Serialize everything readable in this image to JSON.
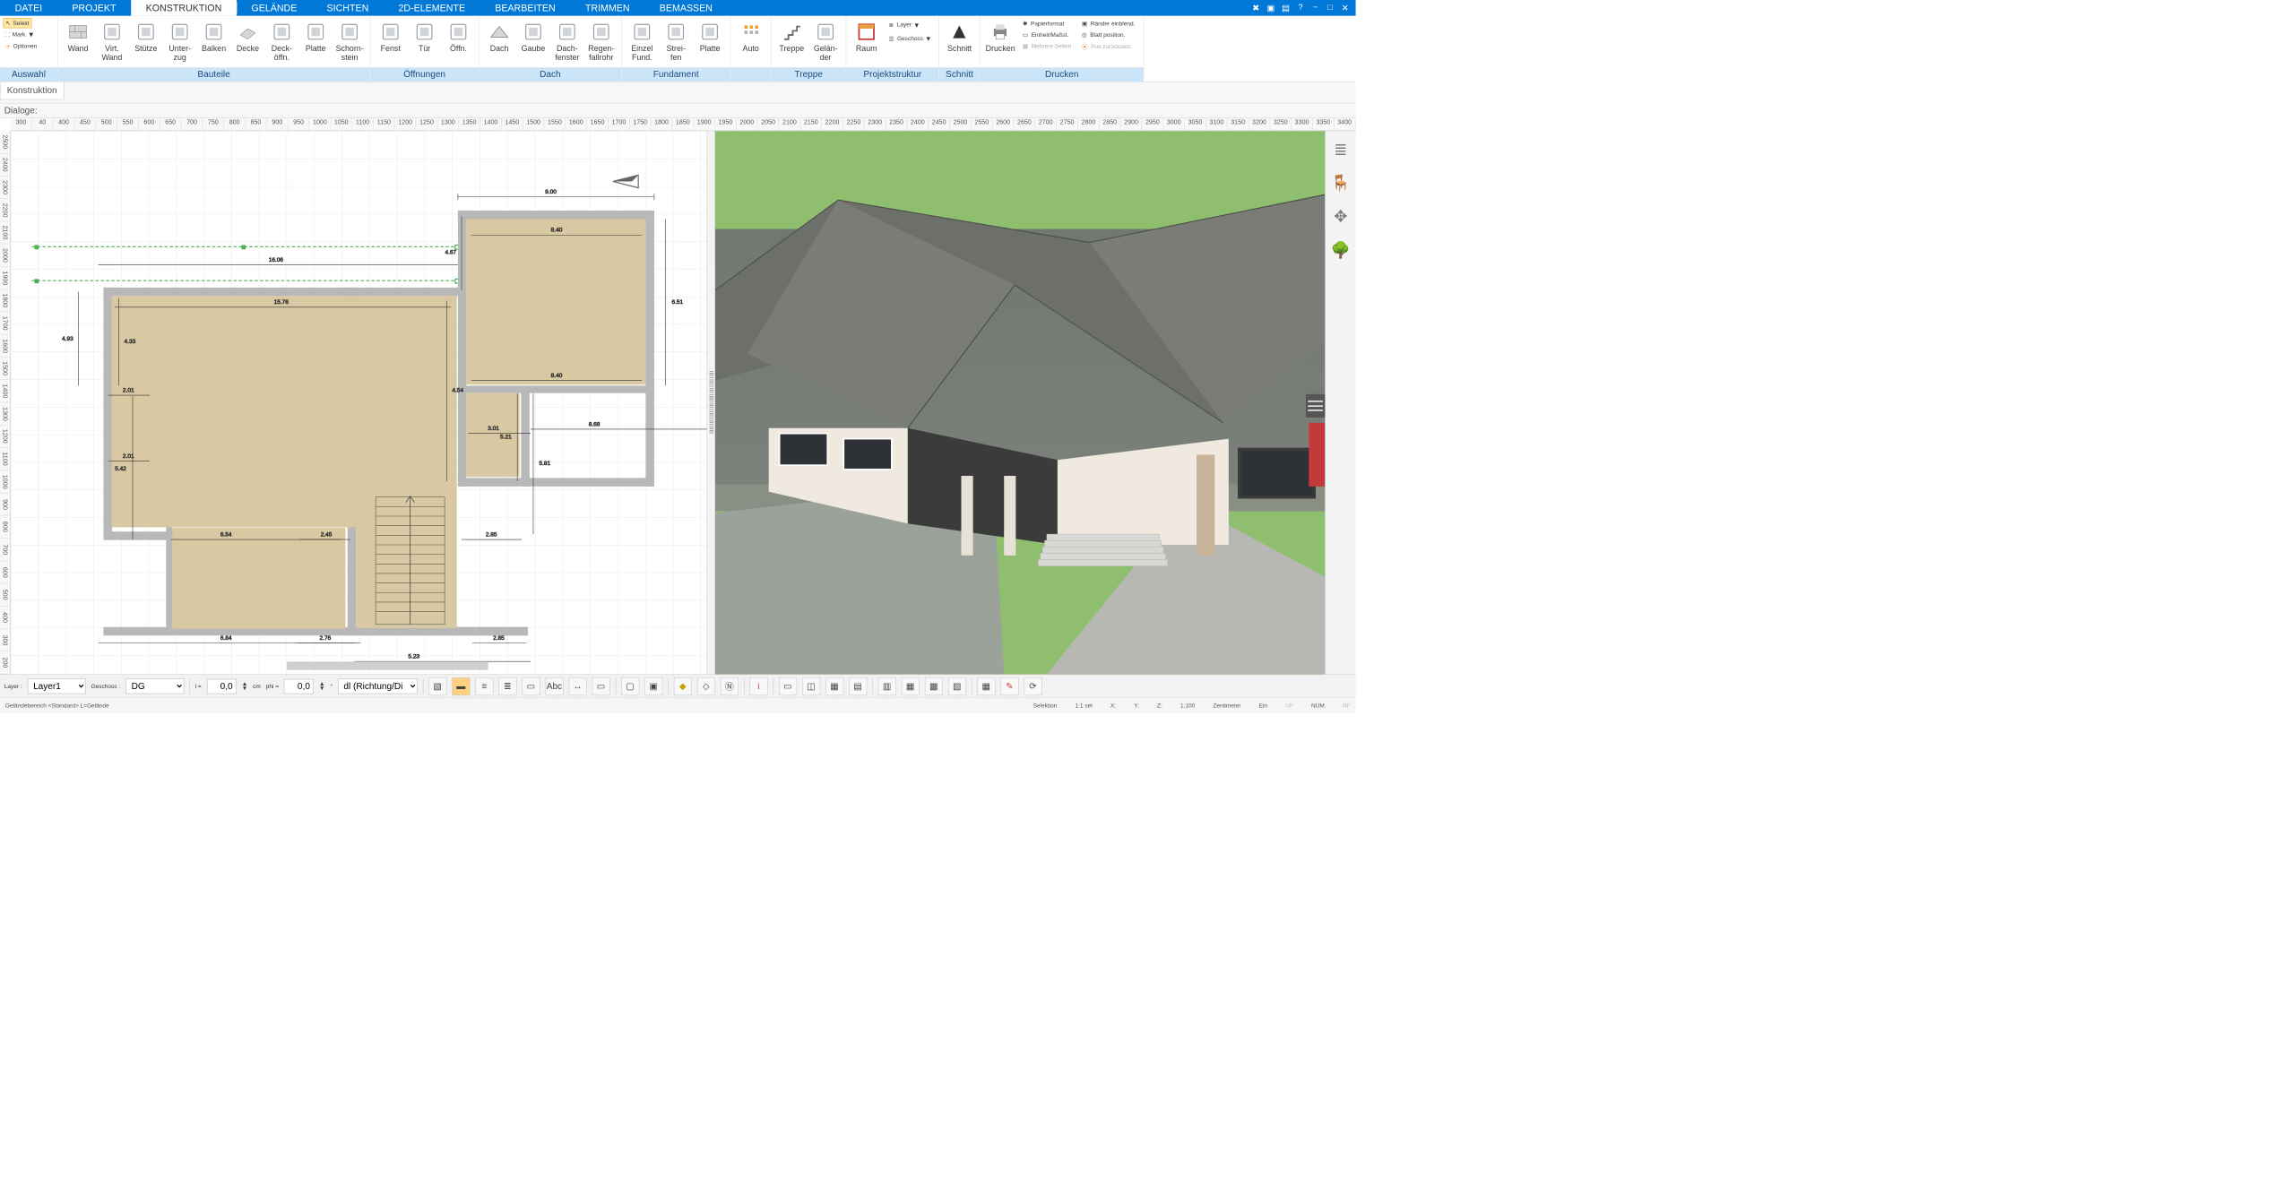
{
  "menu": {
    "tabs": [
      "DATEI",
      "PROJEKT",
      "KONSTRUKTION",
      "GELÄNDE",
      "SICHTEN",
      "2D-ELEMENTE",
      "BEARBEITEN",
      "TRIMMEN",
      "BEMASSEN"
    ],
    "active_index": 2
  },
  "auswahl": {
    "selekt": "Selekt",
    "mark": "Mark.",
    "optionen": "Optionen",
    "label": "Auswahl"
  },
  "bauteile": {
    "label": "Bauteile",
    "items": [
      "Wand",
      "Virt.\nWand",
      "Stütze",
      "Unter-\nzug",
      "Balken",
      "Decke",
      "Deck-\nöffn.",
      "Platte",
      "Schorn-\nstein"
    ]
  },
  "oeffnungen": {
    "label": "Öffnungen",
    "items": [
      "Fenst",
      "Tür",
      "Öffn."
    ]
  },
  "dach": {
    "label": "Dach",
    "items": [
      "Dach",
      "Gaube",
      "Dach-\nfenster",
      "Regen-\nfallrohr"
    ]
  },
  "fundament": {
    "label": "Fundament",
    "items": [
      "Einzel\nFund.",
      "Strei-\nfen",
      "Platte"
    ]
  },
  "auto": {
    "item": "Auto"
  },
  "treppe": {
    "label": "Treppe",
    "items": [
      "Treppe",
      "Gelän-\nder"
    ]
  },
  "projektstruktur": {
    "label": "Projektstruktur",
    "items": [
      "Raum"
    ],
    "side": [
      "Layer",
      "Geschoss"
    ]
  },
  "schnitt": {
    "label": "Schnitt",
    "item": "Schnitt"
  },
  "drucken": {
    "label": "Drucken",
    "item": "Drucken",
    "lists": [
      "Papierformat",
      "Einheit/Maßst.",
      "Mehrere Seiten",
      "Ränder einblend.",
      "Blatt position.",
      "Pos zurücksetz."
    ]
  },
  "info": {
    "tab": "Konstruktion",
    "dialoge": "Dialoge:"
  },
  "ruler_h": [
    300,
    40,
    400,
    450,
    500,
    550,
    600,
    650,
    700,
    750,
    800,
    850,
    900,
    950,
    1000,
    1050,
    1100,
    1150,
    1200,
    1250,
    1300,
    1350,
    1400,
    1450,
    1500,
    1550,
    1600,
    1650,
    1700,
    1750,
    1800,
    1850,
    1900,
    1950,
    2000,
    2050,
    2100,
    2150,
    2200,
    2250,
    2300,
    2350,
    2400,
    2450,
    2500,
    2550,
    2600,
    2650,
    2700,
    2750,
    2800,
    2850,
    2900,
    2950,
    3000,
    3050,
    3100,
    3150,
    3200,
    3250,
    3300,
    3350,
    3400
  ],
  "ruler_v": [
    2500,
    2400,
    2300,
    2200,
    2100,
    2000,
    1900,
    1800,
    1700,
    1600,
    1500,
    1400,
    1300,
    1200,
    1100,
    1000,
    900,
    800,
    700,
    600,
    500,
    400,
    300,
    200
  ],
  "plan_dims": {
    "top_w": "9.00",
    "upper_room_w": "8.40",
    "upper_room_w2": "8.40",
    "upper_room_h": "6.51",
    "main_span": "16.06",
    "main_span2": "15.76",
    "left_h": "4.93",
    "inner_h": "4.33",
    "low_left": "2.01",
    "low_left2": "2.01",
    "low_a": "6.54",
    "low_b": "2.85",
    "low_c": "2.85",
    "low_d": "2.45",
    "low_e": "2.76",
    "bottom_span": "6.84",
    "bottom_span2": "5.23",
    "col_h": "5.42",
    "col_h2": "4.54",
    "col_h3": "5.21",
    "col_h4": "5.81",
    "btn_label": "3.01",
    "ext_span": "8.68",
    "tiny_a": "4.67"
  },
  "bottom_toolbar": {
    "layer_lbl": "Layer :",
    "layer": "Layer1",
    "geschoss_lbl": "Geschoss :",
    "geschoss": "DG",
    "l_lbl": "l =",
    "l_val": "0,0",
    "cm": "cm",
    "phi_lbl": "phi =",
    "phi_val": "0,0",
    "deg": "°",
    "dl": "dl (Richtung/Di"
  },
  "status": {
    "left": "Geländebereich <Standard> L=Gelände",
    "selection": "Selektion",
    "ratio": "1:1 sel",
    "X": "X:",
    "Y": "Y:",
    "Z": "Z:",
    "scale": "1:100",
    "unit": "Zentimeter",
    "ein": "Ein",
    "uf": "UF",
    "num": "NUM",
    "rf": "RF"
  },
  "side_tools": [
    "layers-icon",
    "furniture-icon",
    "move-icon",
    "tree-icon"
  ]
}
